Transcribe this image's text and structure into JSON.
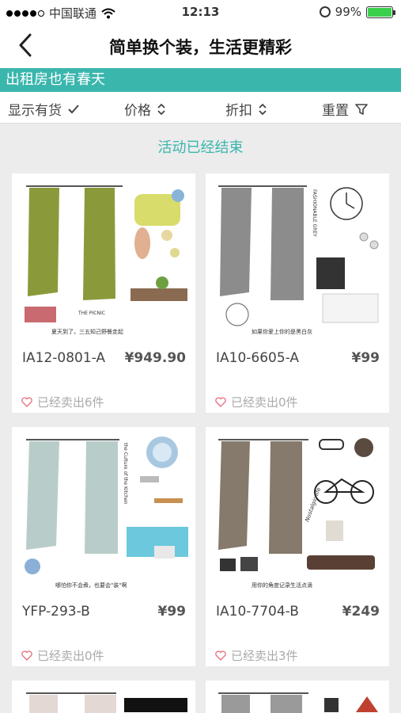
{
  "status_bar": {
    "carrier": "中国联通",
    "time": "12:13",
    "battery": "99%",
    "battery_level": 0.99
  },
  "nav": {
    "title": "简单换个装，生活更精彩"
  },
  "banner": {
    "text": "出租房也有春天"
  },
  "filters": {
    "in_stock": "显示有货",
    "price": "价格",
    "discount": "折扣",
    "reset": "重置"
  },
  "notice": "活动已经结束",
  "products": [
    {
      "code": "IA12-0801-A",
      "price": "¥949.90",
      "sold": "已经卖出6件",
      "curtain_color": "#8a9a3a",
      "caption": "夏天到了，三五知己野餐走起",
      "tag": "THE PICNIC"
    },
    {
      "code": "IA10-6605-A",
      "price": "¥99",
      "sold": "已经卖出0件",
      "curtain_color": "#8c8c8c",
      "caption": "如果你爱上你的是黑白灰",
      "tag": "FASHIONABLE GREY"
    },
    {
      "code": "YFP-293-B",
      "price": "¥99",
      "sold": "已经卖出0件",
      "curtain_color": "#b8cdc9",
      "caption": "哪怕你不会煮，也要会\"装\"啊",
      "tag": "the Culture of the Kitchen"
    },
    {
      "code": "IA10-7704-B",
      "price": "¥249",
      "sold": "已经卖出3件",
      "curtain_color": "#857a6b",
      "caption": "用你的角度记录生活点滴",
      "tag": "Nostalgic life"
    }
  ],
  "colors": {
    "accent": "#3ab6ad",
    "banner_bg": "#3ab6ad",
    "heart": "#e66a7a"
  }
}
